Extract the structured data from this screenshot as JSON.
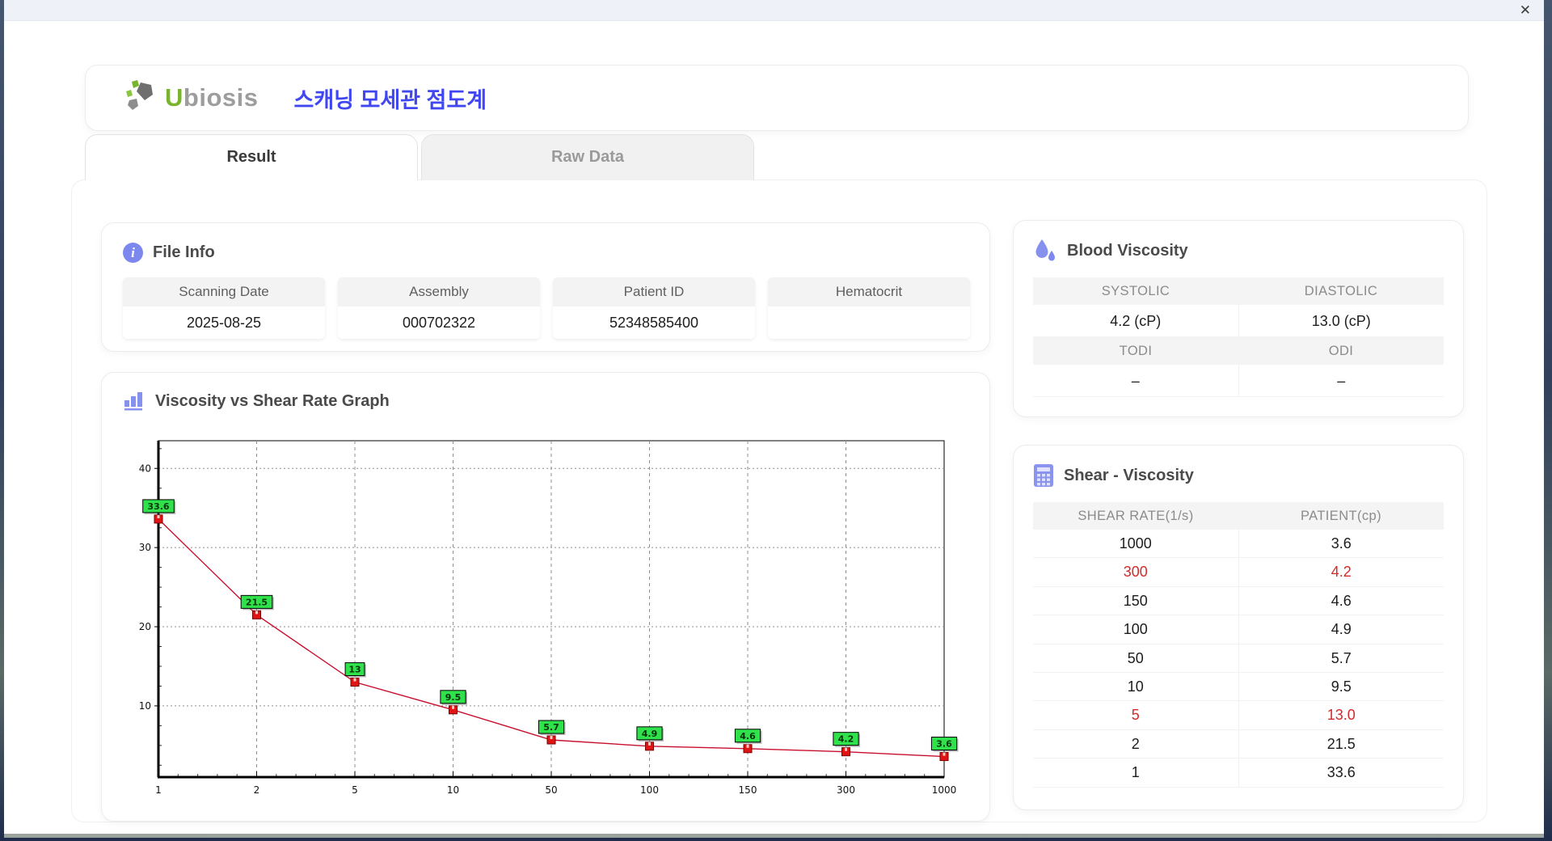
{
  "window": {
    "close_label": "✕"
  },
  "header": {
    "logo_text_u": "U",
    "logo_text_rest": "biosis",
    "app_title": "스캐닝 모세관 점도계"
  },
  "tabs": {
    "result": "Result",
    "raw_data": "Raw Data"
  },
  "file_info": {
    "title": "File Info",
    "fields": [
      {
        "label": "Scanning Date",
        "value": "2025-08-25"
      },
      {
        "label": "Assembly",
        "value": "000702322"
      },
      {
        "label": "Patient ID",
        "value": "52348585400"
      },
      {
        "label": "Hematocrit",
        "value": ""
      }
    ]
  },
  "blood_viscosity": {
    "title": "Blood Viscosity",
    "row1": {
      "headers": [
        "SYSTOLIC",
        "DIASTOLIC"
      ],
      "values": [
        "4.2 (cP)",
        "13.0 (cP)"
      ]
    },
    "row2": {
      "headers": [
        "TODI",
        "ODI"
      ],
      "values": [
        "–",
        "–"
      ]
    }
  },
  "shear_viscosity": {
    "title": "Shear - Viscosity",
    "columns": [
      "SHEAR RATE(1/s)",
      "PATIENT(cp)"
    ],
    "rows": [
      {
        "rate": "1000",
        "patient": "3.6",
        "highlight": false
      },
      {
        "rate": "300",
        "patient": "4.2",
        "highlight": true
      },
      {
        "rate": "150",
        "patient": "4.6",
        "highlight": false
      },
      {
        "rate": "100",
        "patient": "4.9",
        "highlight": false
      },
      {
        "rate": "50",
        "patient": "5.7",
        "highlight": false
      },
      {
        "rate": "10",
        "patient": "9.5",
        "highlight": false
      },
      {
        "rate": "5",
        "patient": "13.0",
        "highlight": true
      },
      {
        "rate": "2",
        "patient": "21.5",
        "highlight": false
      },
      {
        "rate": "1",
        "patient": "33.6",
        "highlight": false
      }
    ],
    "highlight_color": "#d42a2a"
  },
  "graph_section": {
    "title": "Viscosity vs Shear Rate Graph"
  },
  "chart_data": {
    "type": "line",
    "title": "Viscosity vs Shear Rate Graph",
    "x_categories": [
      "1",
      "2",
      "5",
      "10",
      "50",
      "100",
      "150",
      "300",
      "1000"
    ],
    "values": [
      33.6,
      21.5,
      13,
      9.5,
      5.7,
      4.9,
      4.6,
      4.2,
      3.6
    ],
    "point_labels": [
      "33.6",
      "21.5",
      "13",
      "9.5",
      "5.7",
      "4.9",
      "4.6",
      "4.2",
      "3.6"
    ],
    "xlabel": "",
    "ylabel": "",
    "yticks": [
      10,
      20,
      30,
      40
    ],
    "ylim": [
      1,
      43.5
    ],
    "grid": true,
    "legend": false,
    "line_color": "#c8102e",
    "marker_color": "#e01414",
    "marker_border": "#7a0000",
    "label_bg": "#2fe24b",
    "label_border": "#000000",
    "label_text_color": "#0a320a"
  }
}
